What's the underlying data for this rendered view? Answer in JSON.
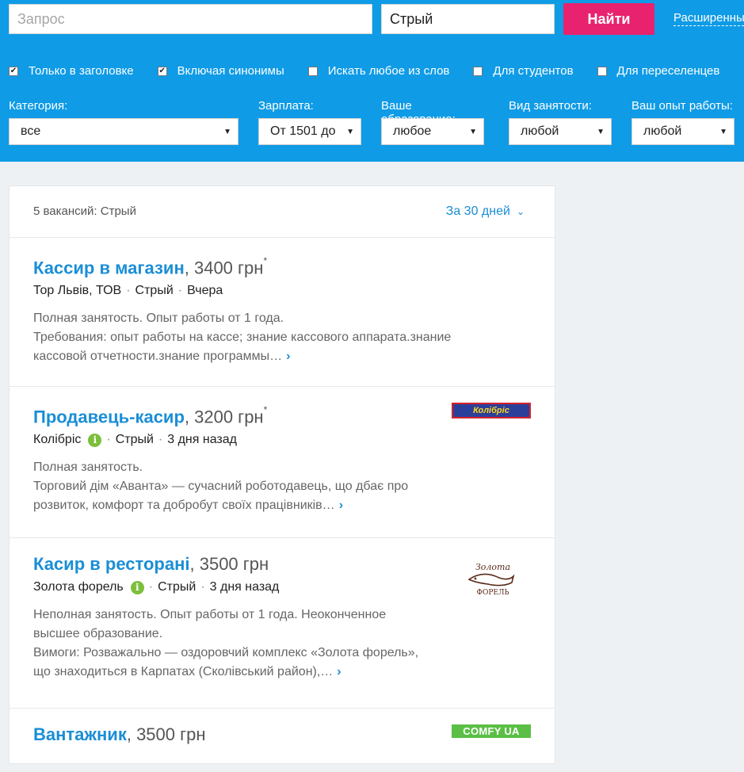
{
  "search": {
    "query_placeholder": "Запрос",
    "query_value": "",
    "location_value": "Стрый",
    "find_label": "Найти",
    "advanced_label": "Расширенный"
  },
  "checks": [
    {
      "label": "Только в заголовке",
      "checked": true
    },
    {
      "label": "Включая синонимы",
      "checked": true
    },
    {
      "label": "Искать любое из слов",
      "checked": false
    },
    {
      "label": "Для студентов",
      "checked": false
    },
    {
      "label": "Для переселенцев",
      "checked": false
    }
  ],
  "filters": {
    "category": {
      "label": "Категория:",
      "value": "все"
    },
    "salary": {
      "label": "Зарплата:",
      "value": "От 1501 до"
    },
    "education": {
      "label": "Ваше образование:",
      "value": "любое"
    },
    "employment": {
      "label": "Вид занятости:",
      "value": "любой"
    },
    "experience": {
      "label": "Ваш опыт работы:",
      "value": "любой"
    }
  },
  "results": {
    "count_text": "5 вакансий: Стрый",
    "period_label": "За 30 дней",
    "vacancies": [
      {
        "title": "Кассир в магазин",
        "salary": ", 3400 грн",
        "star": "*",
        "company": "Тор Львів, ТОВ",
        "city": "Стрый",
        "date": "Вчера",
        "desc": [
          "Полная занятость. Опыт работы от 1 года.",
          "Требования: опыт работы на кассе; знание кассового аппарата.знание",
          "кассовой отчетности.знание программы…"
        ]
      },
      {
        "title": "Продавець-касир",
        "salary": ", 3200 грн",
        "star": "*",
        "company": "Колібріс",
        "city": "Стрый",
        "date": "3 дня назад",
        "logo_text": "Колібріс",
        "desc": [
          "Полная занятость.",
          "Торговий дім «Аванта» — сучасний роботодавець, що дбає про",
          "розвиток, комфорт та добробут своїх працівників…"
        ]
      },
      {
        "title": "Касир в ресторані",
        "salary": ", 3500 грн",
        "company": "Золота форель",
        "city": "Стрый",
        "date": "3 дня назад",
        "logo_text_top": "Золота",
        "logo_text_bottom": "ФОРЕЛЬ",
        "desc": [
          "Неполная занятость. Опыт работы от 1 года. Неоконченное",
          "высшее образование.",
          "Вимоги: Розважально — оздоровчий комплекс «Золота форель»,",
          "що знаходиться в Карпатах (Сколівський район),…"
        ]
      },
      {
        "title": "Вантажник",
        "salary": ", 3500 грн",
        "logo_text": "COMFY UA"
      }
    ]
  },
  "colors": {
    "topbar": "#0f9be6",
    "accent": "#1a8ed6",
    "button": "#e8226e"
  },
  "icons": {
    "info": "info-icon",
    "chevron": "chevron-down-icon",
    "more": "chevron-right-icon"
  }
}
